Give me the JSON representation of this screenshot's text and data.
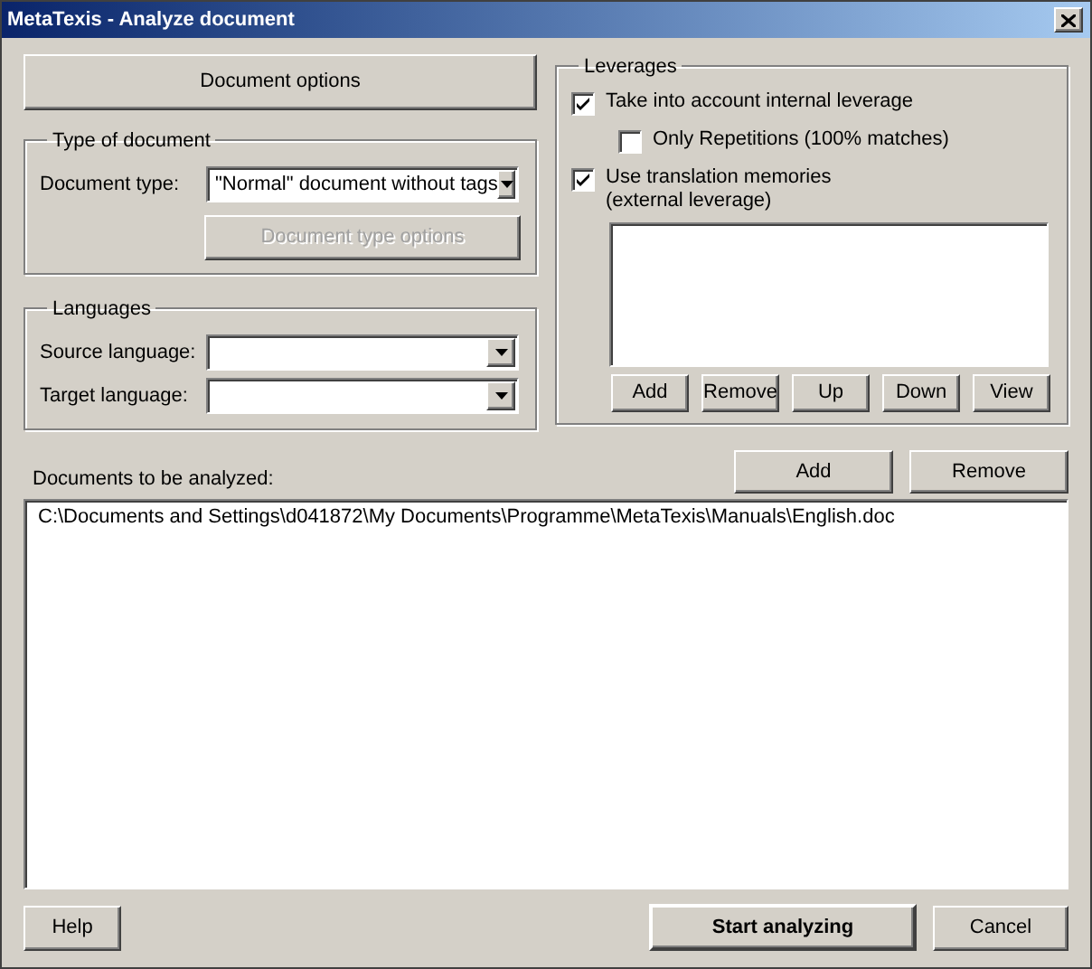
{
  "window": {
    "title": "MetaTexis - Analyze document"
  },
  "document_options_button": {
    "label": "Document options"
  },
  "type_of_document": {
    "title": "Type of document",
    "fields": [
      {
        "label": "Document type:",
        "value": "\"Normal\" document without tags"
      }
    ],
    "options_button": {
      "label": "Document type options",
      "disabled": true
    }
  },
  "languages": {
    "title": "Languages",
    "fields": [
      {
        "label": "Source language:"
      },
      {
        "label": "Target language:"
      }
    ]
  },
  "leverages": {
    "title": "Leverages",
    "options": [
      {
        "label": "Take into account internal leverage",
        "checked": true,
        "children": [
          {
            "label": "Only Repetitions (100% matches)",
            "checked": false
          }
        ]
      },
      {
        "label": "Use translation memories\n(external leverage)",
        "checked": true
      }
    ],
    "buttons": [
      "Add",
      "Remove",
      "Up",
      "Down",
      "View"
    ]
  },
  "documents": {
    "label": "Documents to be analyzed:",
    "buttons": [
      "Add",
      "Remove"
    ],
    "items": [
      "C:\\Documents and Settings\\d041872\\My Documents\\Programme\\MetaTexis\\Manuals\\English.doc"
    ]
  },
  "footer_buttons": [
    {
      "label": "Help",
      "kind": "normal"
    },
    {
      "label": "Start analyzing",
      "kind": "default"
    },
    {
      "label": "Cancel",
      "kind": "normal"
    }
  ]
}
